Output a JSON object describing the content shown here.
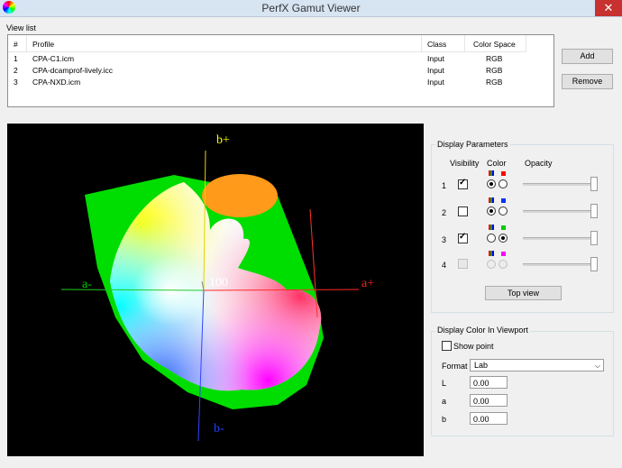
{
  "window": {
    "title": "PerfX Gamut Viewer",
    "close_glyph": "✕",
    "app_icon": "color-wheel-icon"
  },
  "view_list": {
    "label": "View list",
    "columns": [
      "#",
      "Profile",
      "Class",
      "Color Space"
    ],
    "rows": [
      {
        "num": "1",
        "profile": "CPA-C1.icm",
        "class": "Input",
        "space": "RGB"
      },
      {
        "num": "2",
        "profile": "CPA-dcamprof-lively.icc",
        "class": "Input",
        "space": "RGB"
      },
      {
        "num": "3",
        "profile": "CPA-NXD.icm",
        "class": "Input",
        "space": "RGB"
      }
    ]
  },
  "buttons": {
    "add": "Add",
    "remove": "Remove",
    "top_view": "Top view"
  },
  "viewport": {
    "labels": {
      "b_plus": "b+",
      "b_minus": "b-",
      "a_plus": "a+",
      "a_minus": "a-",
      "center": "100"
    },
    "colors": {
      "b_plus": "#ffff00",
      "b_minus": "#2244ff",
      "a_plus": "#ff2020",
      "a_minus": "#00cc00",
      "center": "#ffffff"
    }
  },
  "display_params": {
    "title": "Display Parameters",
    "headers": {
      "visibility": "Visibility",
      "color": "Color",
      "opacity": "Opacity"
    },
    "rows": [
      {
        "num": "1",
        "visible": true,
        "enabled": true,
        "swatch": "#ff0000",
        "selected": "multi",
        "opacity": 1.0
      },
      {
        "num": "2",
        "visible": false,
        "enabled": true,
        "swatch": "#0033ff",
        "selected": "multi",
        "opacity": 1.0
      },
      {
        "num": "3",
        "visible": true,
        "enabled": true,
        "swatch": "#00cc00",
        "selected": "single",
        "opacity": 1.0
      },
      {
        "num": "4",
        "visible": false,
        "enabled": false,
        "swatch": "#ff00ff",
        "selected": "none",
        "opacity": 1.0
      }
    ]
  },
  "display_color": {
    "title": "Display Color In Viewport",
    "show_point": "Show point",
    "format_label": "Format",
    "format_value": "Lab",
    "fields": [
      {
        "label": "L",
        "value": "0.00"
      },
      {
        "label": "a",
        "value": "0.00"
      },
      {
        "label": "b",
        "value": "0.00"
      }
    ]
  }
}
